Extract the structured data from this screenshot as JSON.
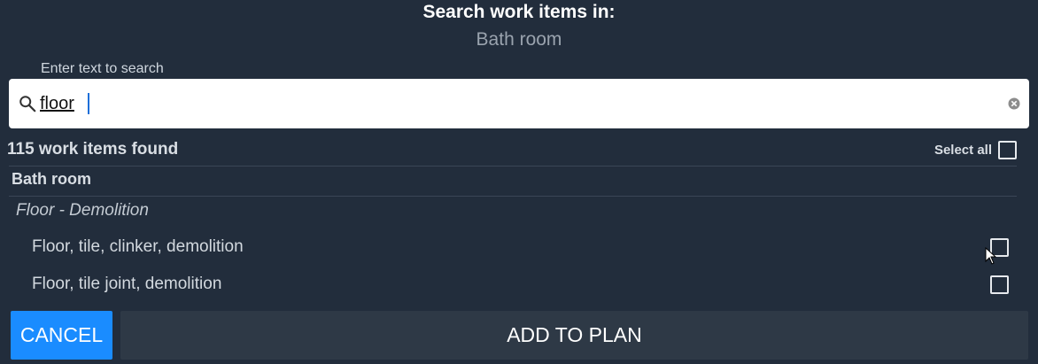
{
  "dialog": {
    "title": "Search work items in:",
    "subtitle": "Bath room"
  },
  "search": {
    "label": "Enter text to search",
    "value": "floor",
    "icon": "search-icon",
    "clear_icon": "clear-icon"
  },
  "results": {
    "count_text": "115 work items found",
    "select_all_label": "Select all",
    "select_all_checked": false
  },
  "group": {
    "title": "Bath room",
    "category": "Floor - Demolition",
    "items": [
      {
        "label": "Floor, tile, clinker, demolition",
        "checked": false
      },
      {
        "label": "Floor, tile joint, demolition",
        "checked": false
      }
    ]
  },
  "actions": {
    "cancel_label": "CANCEL",
    "add_label": "ADD TO PLAN"
  },
  "colors": {
    "background": "#222d3c",
    "primary_button": "#1a8cff",
    "secondary_button": "#2e3946",
    "caret": "#1e6fd9"
  }
}
